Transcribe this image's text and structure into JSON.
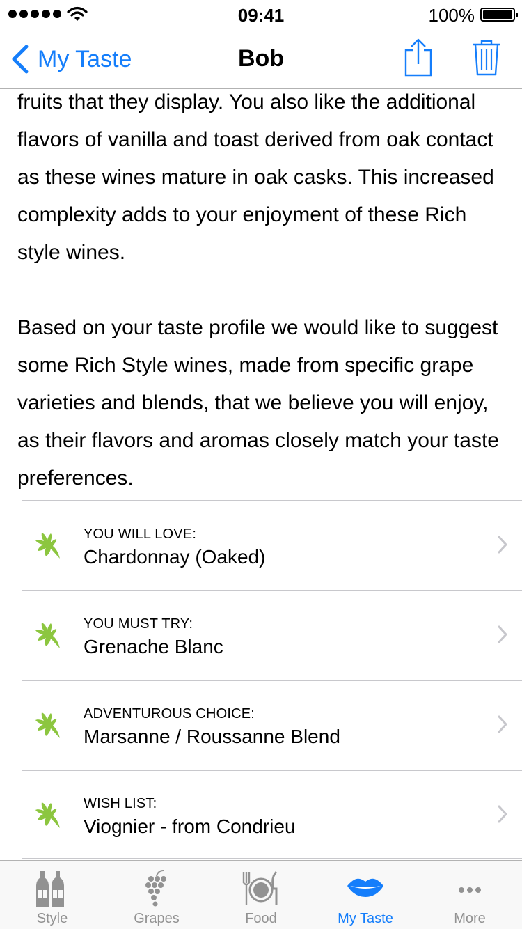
{
  "status_bar": {
    "time": "09:41",
    "battery": "100%",
    "signal_icon": "signal-dots-icon",
    "wifi_icon": "wifi-icon",
    "battery_icon": "battery-icon"
  },
  "nav": {
    "back_label": "My Taste",
    "title": "Bob",
    "share_icon": "share-icon",
    "trash_icon": "trash-icon",
    "accent_color": "#157efb"
  },
  "body": {
    "paragraphs": [
      "fruits that they display. You also like the additional flavors of vanilla and toast derived from oak contact as these wines mature in oak casks. This increased complexity adds to your enjoyment of these Rich style wines.",
      "Based on your taste profile we would like to suggest some Rich Style wines, made from specific grape varieties and blends, that we believe you will enjoy, as their flavors and aromas closely match your taste preferences."
    ]
  },
  "recommendations": [
    {
      "caption": "YOU WILL LOVE:",
      "title": "Chardonnay (Oaked)",
      "icon": "leaf-icon"
    },
    {
      "caption": "YOU MUST TRY:",
      "title": "Grenache Blanc",
      "icon": "leaf-icon"
    },
    {
      "caption": "ADVENTUROUS CHOICE:",
      "title": "Marsanne / Roussanne Blend",
      "icon": "leaf-icon"
    },
    {
      "caption": "WISH LIST:",
      "title": "Viognier - from Condrieu",
      "icon": "leaf-icon"
    }
  ],
  "leaf_color": "#8cc63f",
  "tab_bar": {
    "tabs": [
      {
        "label": "Style",
        "icon": "wine-bottles-icon",
        "active": false
      },
      {
        "label": "Grapes",
        "icon": "grapes-icon",
        "active": false
      },
      {
        "label": "Food",
        "icon": "plate-cutlery-icon",
        "active": false
      },
      {
        "label": "My Taste",
        "icon": "lips-icon",
        "active": true
      },
      {
        "label": "More",
        "icon": "more-dots-icon",
        "active": false
      }
    ]
  }
}
